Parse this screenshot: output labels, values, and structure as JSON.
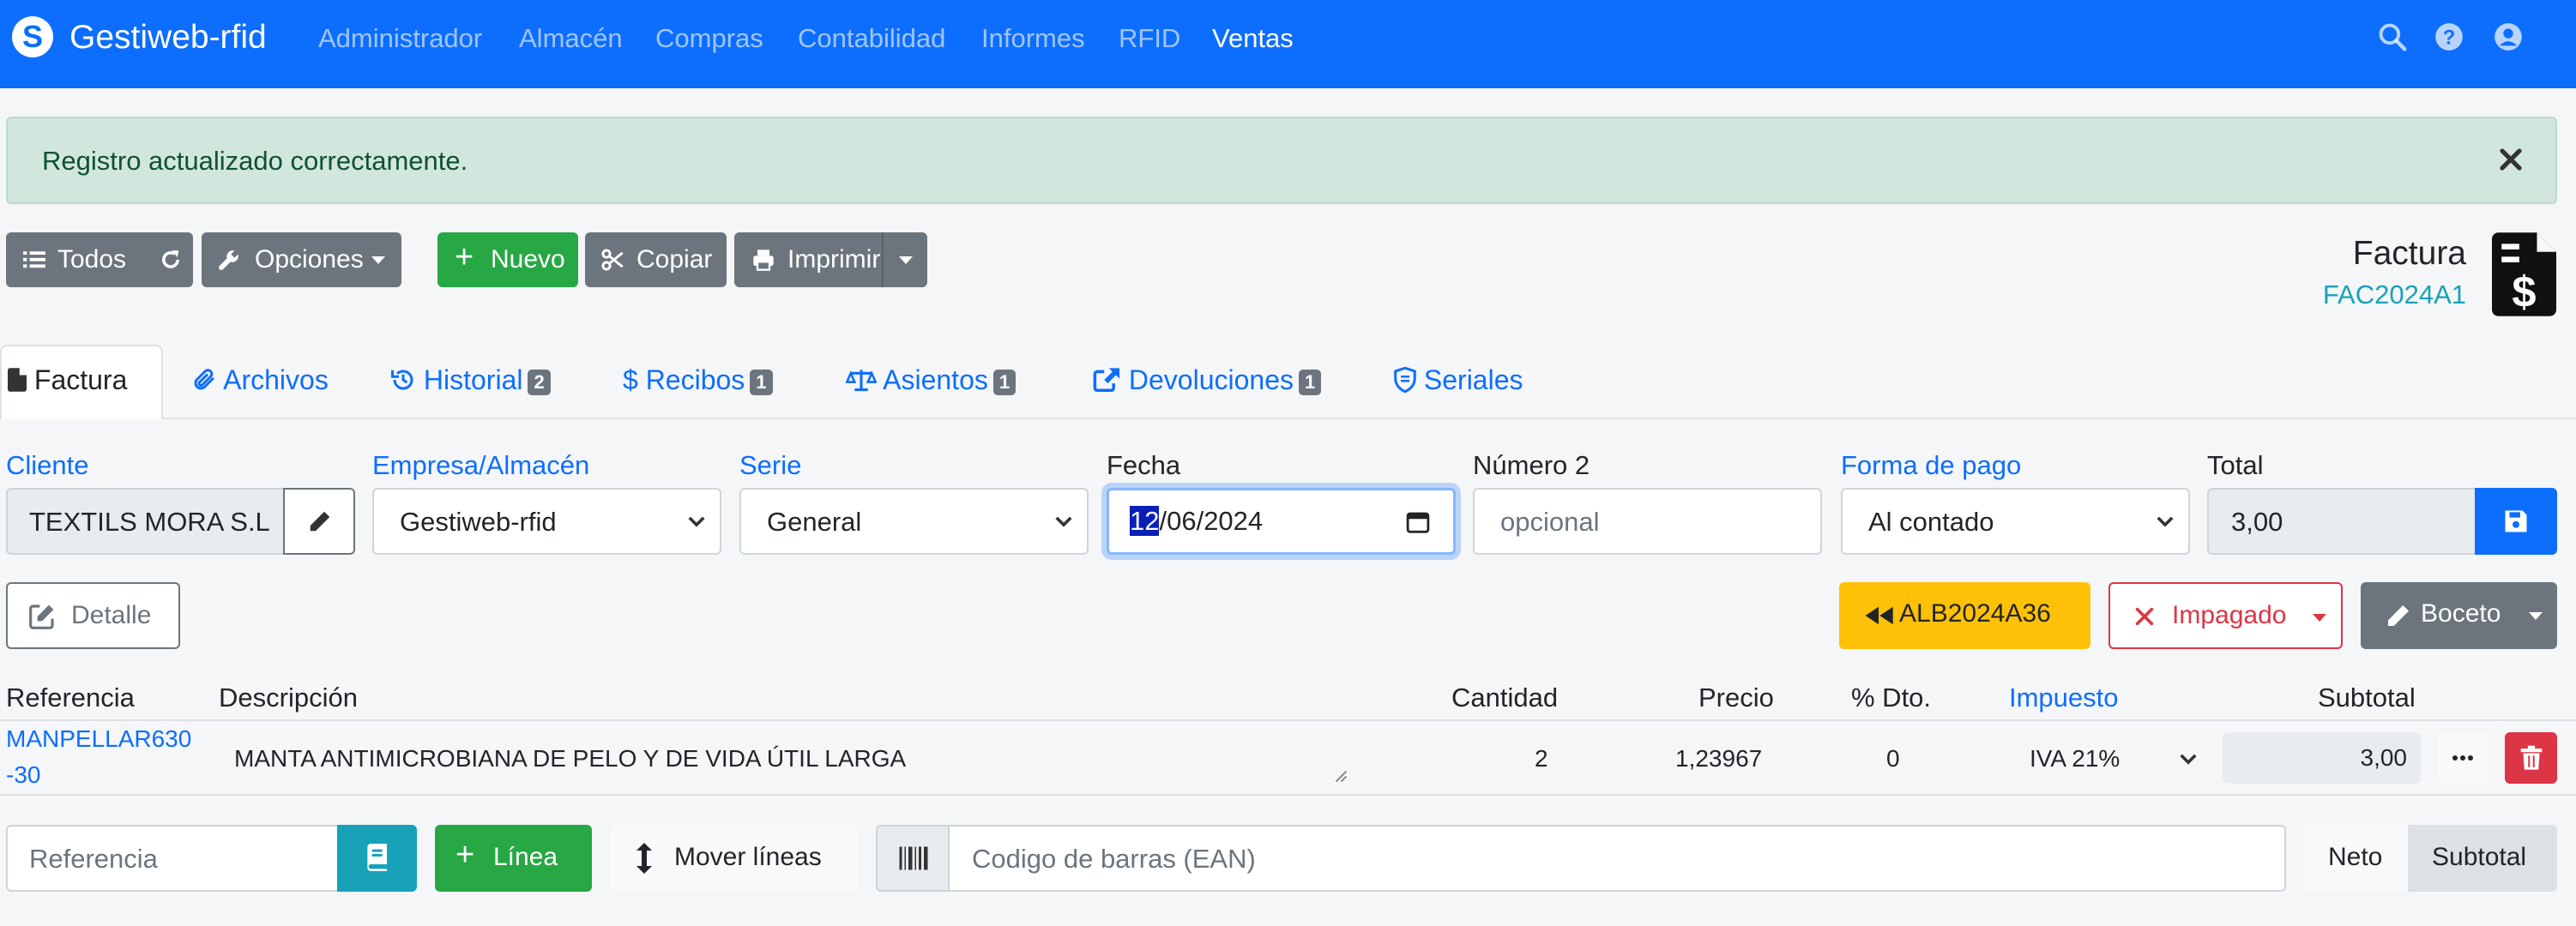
{
  "app": {
    "brand": "Gestiweb-rfid",
    "nav": [
      "Administrador",
      "Almacén",
      "Compras",
      "Contabilidad",
      "Informes",
      "RFID",
      "Ventas"
    ],
    "active_nav": "Ventas"
  },
  "alert": {
    "message": "Registro actualizado correctamente."
  },
  "toolbar": {
    "all_label": "Todos",
    "options_label": "Opciones",
    "new_label": "Nuevo",
    "copy_label": "Copiar",
    "print_label": "Imprimir"
  },
  "document": {
    "title": "Factura",
    "code": "FAC2024A1"
  },
  "tabs": [
    {
      "label": "Factura",
      "icon": "file-icon"
    },
    {
      "label": "Archivos",
      "icon": "paperclip-icon"
    },
    {
      "label": "Historial",
      "badge": "2",
      "icon": "history-icon"
    },
    {
      "label": "Recibos",
      "badge": "1",
      "icon": "dollar-icon"
    },
    {
      "label": "Asientos",
      "badge": "1",
      "icon": "balance-scale-icon"
    },
    {
      "label": "Devoluciones",
      "badge": "1",
      "icon": "share-icon"
    },
    {
      "label": "Seriales",
      "icon": "shield-icon"
    }
  ],
  "form": {
    "cliente_label": "Cliente",
    "cliente_value": "TEXTILS MORA S.L.",
    "empresa_label": "Empresa/Almacén",
    "empresa_value": "Gestiweb-rfid",
    "serie_label": "Serie",
    "serie_value": "General",
    "fecha_label": "Fecha",
    "fecha_day": "12",
    "fecha_rest": "/06/2024",
    "numero2_label": "Número 2",
    "numero2_placeholder": "opcional",
    "pago_label": "Forma de pago",
    "pago_value": "Al contado",
    "total_label": "Total",
    "total_value": "3,00"
  },
  "actions": {
    "detalle_label": "Detalle",
    "albaran_label": "ALB2024A36",
    "impagado_label": "Impagado",
    "boceto_label": "Boceto"
  },
  "colors": {
    "primary": "#0d6efd",
    "success": "#28a745",
    "warning": "#ffc107",
    "danger": "#dc3545",
    "secondary": "#6c757d",
    "info": "#17a2b8"
  },
  "table": {
    "headers": {
      "referencia": "Referencia",
      "descripcion": "Descripción",
      "cantidad": "Cantidad",
      "precio": "Precio",
      "dto": "% Dto.",
      "impuesto": "Impuesto",
      "subtotal": "Subtotal"
    },
    "rows": [
      {
        "ref_line1": "MANPELLAR630",
        "ref_line2": "-30",
        "descripcion": "MANTA ANTIMICROBIANA DE PELO Y DE VIDA ÚTIL LARGA",
        "cantidad": "2",
        "precio": "1,23967",
        "dto": "0",
        "impuesto": "IVA 21%",
        "subtotal": "3,00"
      }
    ]
  },
  "footer": {
    "referencia_placeholder": "Referencia",
    "linea_label": "Línea",
    "mover_label": "Mover líneas",
    "barcode_placeholder": "Codigo de barras (EAN)",
    "neto_label": "Neto",
    "subtotal_label": "Subtotal"
  }
}
